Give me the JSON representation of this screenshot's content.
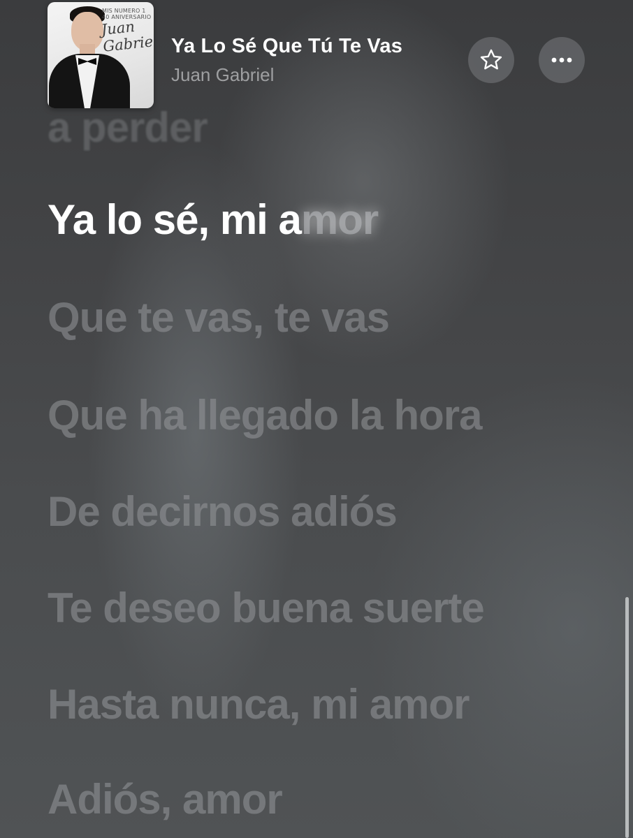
{
  "now_playing": {
    "album_art_top": "MIS NUMERO 1\n40 ANIVERSARIO",
    "album_art_signature": "Juan Gabriel",
    "title": "Ya Lo Sé Que Tú Te Vas",
    "artist": "Juan Gabriel"
  },
  "icons": {
    "favorite": "star-outline-icon",
    "more": "ellipsis-icon"
  },
  "lyrics": {
    "previous_line": "a perder",
    "current_line_sung": "Ya lo sé, mi a",
    "current_line_unsung": "mor",
    "upcoming": [
      "Que te vas, te vas",
      "Que ha llegado la hora",
      "De decirnos adiós",
      "Te deseo buena suerte",
      "Hasta nunca, mi amor",
      "Adiós, amor"
    ]
  }
}
